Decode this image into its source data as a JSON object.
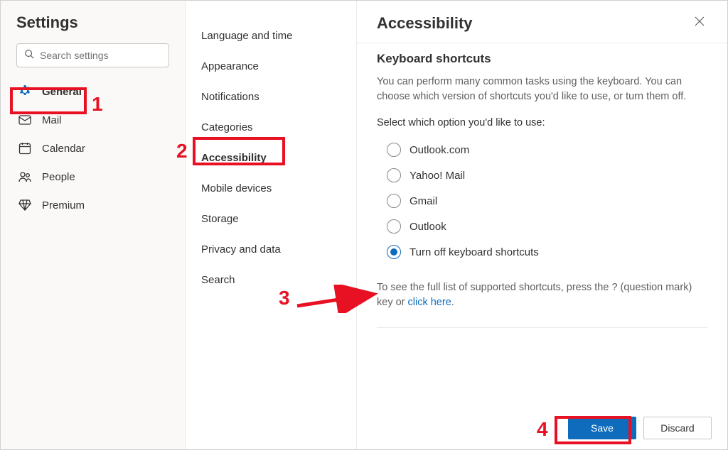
{
  "header": {
    "title": "Settings"
  },
  "search": {
    "placeholder": "Search settings"
  },
  "primary_nav": [
    {
      "label": "General",
      "icon": "gear-icon",
      "active": true
    },
    {
      "label": "Mail",
      "icon": "mail-icon",
      "active": false
    },
    {
      "label": "Calendar",
      "icon": "calendar-icon",
      "active": false
    },
    {
      "label": "People",
      "icon": "people-icon",
      "active": false
    },
    {
      "label": "Premium",
      "icon": "diamond-icon",
      "active": false
    }
  ],
  "sub_nav": [
    {
      "label": "Language and time",
      "active": false
    },
    {
      "label": "Appearance",
      "active": false
    },
    {
      "label": "Notifications",
      "active": false
    },
    {
      "label": "Categories",
      "active": false
    },
    {
      "label": "Accessibility",
      "active": true
    },
    {
      "label": "Mobile devices",
      "active": false
    },
    {
      "label": "Storage",
      "active": false
    },
    {
      "label": "Privacy and data",
      "active": false
    },
    {
      "label": "Search",
      "active": false
    }
  ],
  "panel": {
    "title": "Accessibility",
    "section_heading": "Keyboard shortcuts",
    "section_desc": "You can perform many common tasks using the keyboard. You can choose which version of shortcuts you'd like to use, or turn them off.",
    "select_label": "Select which option you'd like to use:",
    "options": [
      {
        "label": "Outlook.com",
        "selected": false
      },
      {
        "label": "Yahoo! Mail",
        "selected": false
      },
      {
        "label": "Gmail",
        "selected": false
      },
      {
        "label": "Outlook",
        "selected": false
      },
      {
        "label": "Turn off keyboard shortcuts",
        "selected": true
      }
    ],
    "footnote_pre": "To see the full list of supported shortcuts, press the ? (question mark) key or ",
    "footnote_link": "click here",
    "footnote_post": "."
  },
  "footer": {
    "save": "Save",
    "discard": "Discard"
  },
  "annotations": {
    "n1": "1",
    "n2": "2",
    "n3": "3",
    "n4": "4"
  }
}
